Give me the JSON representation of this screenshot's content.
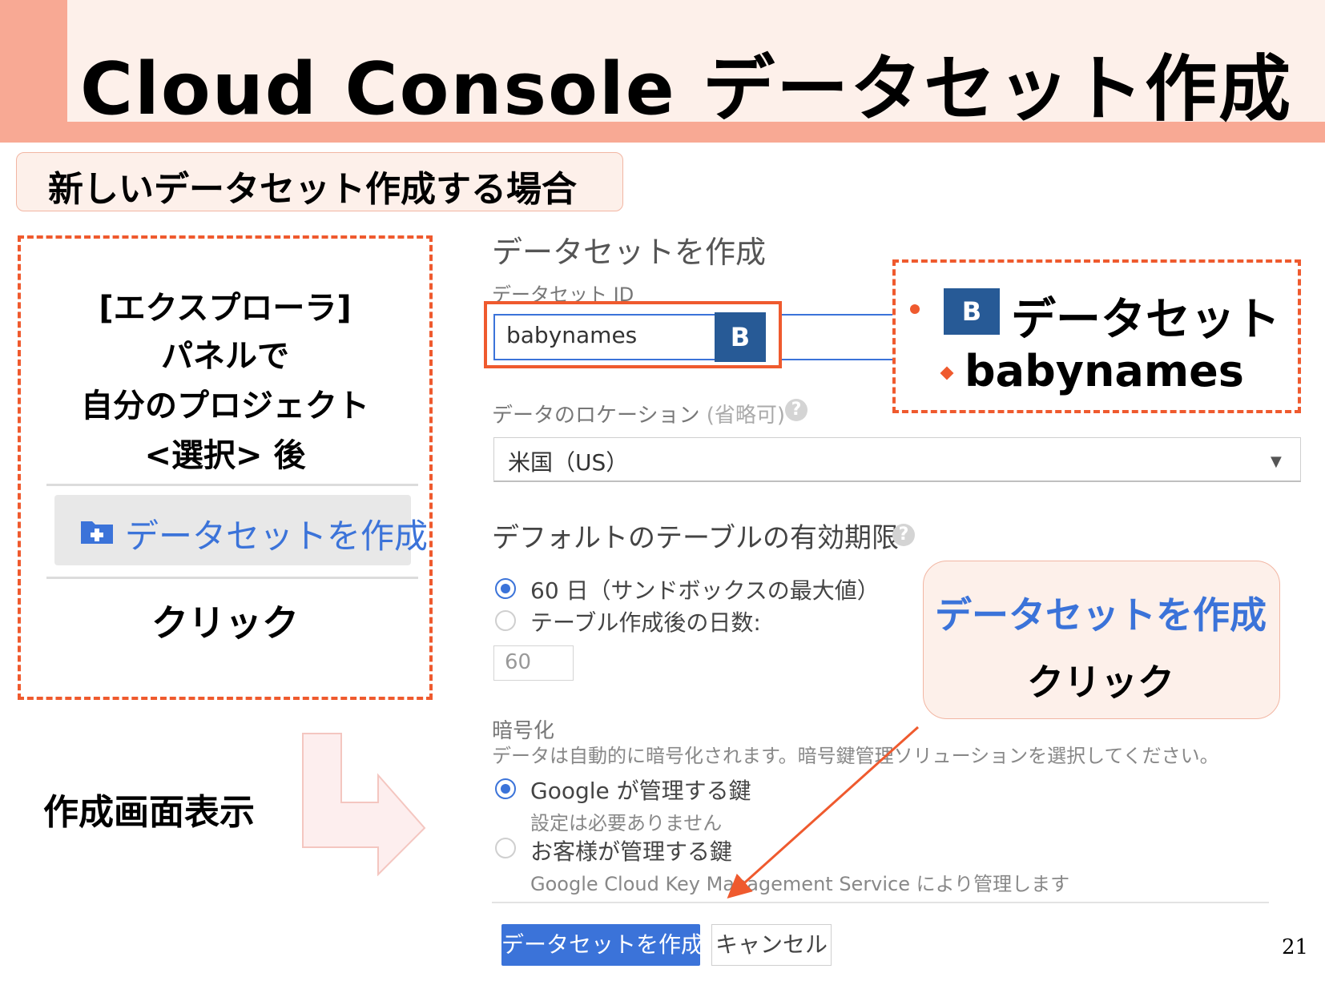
{
  "slide": {
    "title": "Cloud Console データセット作成",
    "subtitle": "新しいデータセット作成する場合",
    "page_number": "21"
  },
  "left_panel": {
    "lines": [
      "[エクスプローラ]",
      "パネルで",
      "自分のプロジェクト",
      "<選択> 後"
    ],
    "create_button_label": "データセットを作成",
    "click_label": "クリック"
  },
  "create_screen_label": "作成画面表示",
  "form": {
    "heading": "データセットを作成",
    "dataset_id_label": "データセット ID",
    "dataset_id_value": "babynames",
    "badge": "B",
    "location_label": "データのロケーション",
    "location_optional": "(省略可)",
    "location_value": "米国（US）",
    "expiration_heading": "デフォルトのテーブルの有効期限",
    "expiration_options": [
      {
        "label": "60 日（サンドボックスの最大値）",
        "selected": true
      },
      {
        "label": "テーブル作成後の日数:",
        "selected": false
      }
    ],
    "days_value": "60",
    "encryption_heading": "暗号化",
    "encryption_desc": "データは自動的に暗号化されます。暗号鍵管理ソリューションを選択してください。",
    "encryption_options": [
      {
        "label": "Google が管理する鍵",
        "note": "設定は必要ありません",
        "selected": true
      },
      {
        "label": "お客様が管理する鍵",
        "note": "Google Cloud Key Management Service により管理します",
        "selected": false
      }
    ],
    "create_button": "データセットを作成",
    "cancel_button": "キャンセル"
  },
  "callouts": {
    "dataset_badge": "B",
    "dataset_label": "データセット",
    "dataset_value": "babynames",
    "create_label": "データセットを作成",
    "create_click": "クリック"
  },
  "colors": {
    "accent": "#ef5a2e",
    "title_band": "#f8a994",
    "title_bg": "#fdf0ea",
    "link_blue": "#3b73d9",
    "badge_blue": "#275a96"
  }
}
